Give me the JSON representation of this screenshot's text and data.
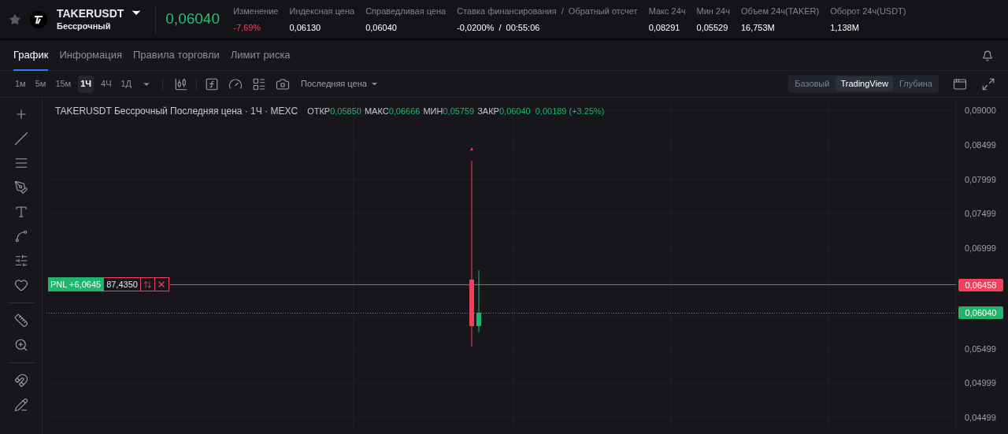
{
  "header": {
    "symbol": "TAKERUSDT",
    "subtitle": "Бессрочный",
    "price": "0,06040",
    "stats": [
      {
        "label": "Изменение",
        "value": "-7,69%",
        "kind": "down"
      },
      {
        "label": "Индексная цена",
        "value": "0,06130",
        "kind": "neutral"
      },
      {
        "label": "Справедливая цена",
        "value": "0,06040",
        "kind": "neutral"
      },
      {
        "label": "Ставка финансирования  /  Обратный отсчет",
        "value": "-0,0200%  /  00:55:06",
        "kind": "neutral"
      },
      {
        "label": "Макс 24ч",
        "value": "0,08291",
        "kind": "neutral"
      },
      {
        "label": "Мин 24ч",
        "value": "0,05529",
        "kind": "neutral"
      },
      {
        "label": "Объем 24ч(TAKER)",
        "value": "16,753M",
        "kind": "neutral"
      },
      {
        "label": "Оборот 24ч(USDT)",
        "value": "1,138M",
        "kind": "neutral"
      }
    ]
  },
  "tabs": [
    {
      "label": "График",
      "selected": true
    },
    {
      "label": "Информация",
      "selected": false
    },
    {
      "label": "Правила торговли",
      "selected": false
    },
    {
      "label": "Лимит риска",
      "selected": false
    }
  ],
  "intervals": [
    {
      "label": "1м",
      "selected": false
    },
    {
      "label": "5м",
      "selected": false
    },
    {
      "label": "15м",
      "selected": false
    },
    {
      "label": "1Ч",
      "selected": true
    },
    {
      "label": "4Ч",
      "selected": false
    },
    {
      "label": "1Д",
      "selected": false
    }
  ],
  "price_type": "Последняя цена",
  "views": [
    {
      "label": "Базовый",
      "selected": false
    },
    {
      "label": "TradingView",
      "selected": true
    },
    {
      "label": "Глубина",
      "selected": false
    }
  ],
  "legend": {
    "title": "TAKERUSDT Бессрочный Последняя цена · 1Ч · MEXC",
    "fields": [
      {
        "label": "ОТКР",
        "value": "0,05850"
      },
      {
        "label": "МАКС",
        "value": "0,06666"
      },
      {
        "label": "МИН",
        "value": "0,05759"
      },
      {
        "label": "ЗАКР",
        "value": "0,06040"
      }
    ],
    "change": "0,00189 (+3.25%)"
  },
  "price_axis": [
    "0,09000",
    "0,08499",
    "0,07999",
    "0,07499",
    "0,06999",
    "0,05499",
    "0,04999",
    "0,04499"
  ],
  "badges": [
    {
      "value": "0,06458",
      "kind": "position"
    },
    {
      "value": "0,06040",
      "kind": "last"
    }
  ],
  "position": {
    "pnl": "PNL +6,0645",
    "quantity": "87,4350"
  }
}
